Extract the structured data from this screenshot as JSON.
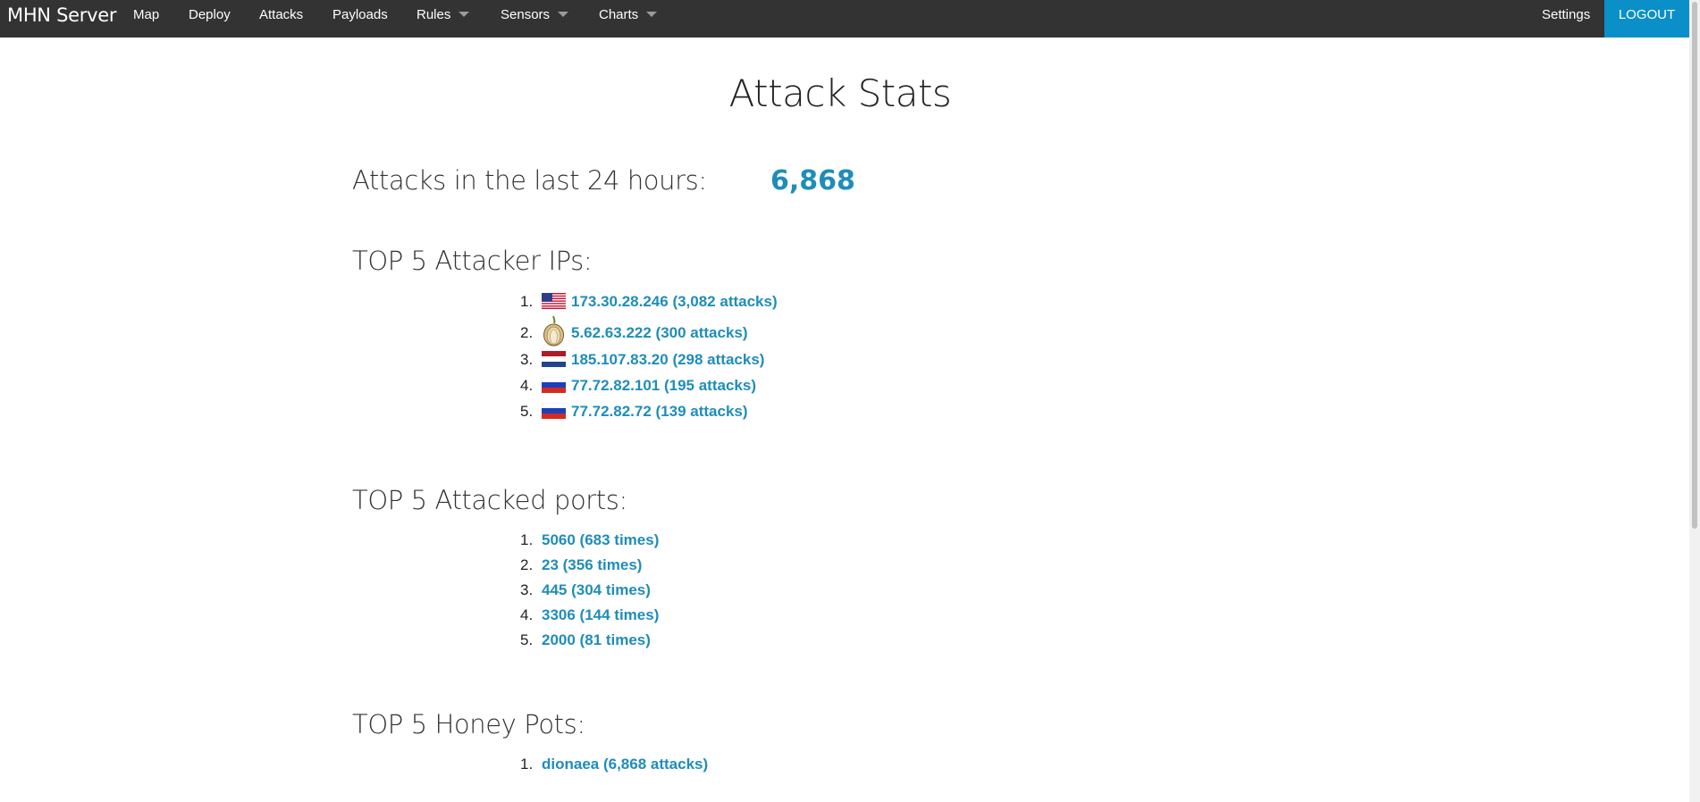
{
  "nav": {
    "brand": "MHN Server",
    "items": [
      {
        "label": "Map"
      },
      {
        "label": "Deploy"
      },
      {
        "label": "Attacks"
      },
      {
        "label": "Payloads"
      },
      {
        "label": "Rules"
      },
      {
        "label": "Sensors"
      },
      {
        "label": "Charts"
      }
    ],
    "settings": "Settings",
    "logout": "LOGOUT"
  },
  "page": {
    "title": "Attack Stats",
    "attacks_label": "Attacks in the last 24 hours:",
    "attacks_count": "6,868"
  },
  "attacker_ips": {
    "heading": "TOP 5 Attacker IPs:",
    "items": [
      {
        "num": "1.",
        "icon": "us-flag-icon",
        "text": "173.30.28.246 (3,082 attacks)"
      },
      {
        "num": "2.",
        "icon": "tor-onion-icon",
        "text": "5.62.63.222 (300 attacks)"
      },
      {
        "num": "3.",
        "icon": "nl-flag-icon",
        "text": "185.107.83.20 (298 attacks)"
      },
      {
        "num": "4.",
        "icon": "ru-flag-icon",
        "text": "77.72.82.101 (195 attacks)"
      },
      {
        "num": "5.",
        "icon": "ru-flag-icon",
        "text": "77.72.82.72 (139 attacks)"
      }
    ]
  },
  "attacked_ports": {
    "heading": "TOP 5 Attacked ports:",
    "items": [
      {
        "num": "1.",
        "text": "5060 (683 times)"
      },
      {
        "num": "2.",
        "text": "23 (356 times)"
      },
      {
        "num": "3.",
        "text": "445 (304 times)"
      },
      {
        "num": "4.",
        "text": "3306 (144 times)"
      },
      {
        "num": "5.",
        "text": "2000 (81 times)"
      }
    ]
  },
  "honey_pots": {
    "heading": "TOP 5 Honey Pots:",
    "items": [
      {
        "num": "1.",
        "text": "dionaea (6,868 attacks)"
      }
    ]
  },
  "colors": {
    "navbar": "#333333",
    "logout_bg": "#0b8fc8",
    "link": "#1f8db8"
  }
}
